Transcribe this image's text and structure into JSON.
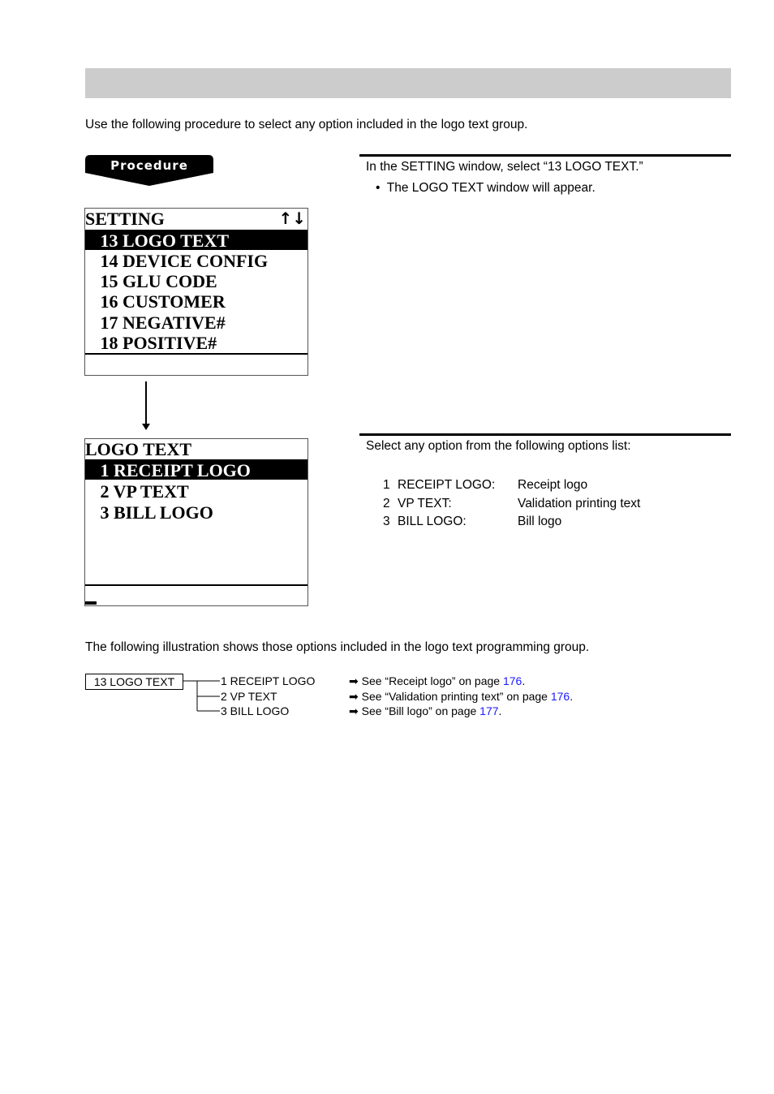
{
  "header": {
    "title": ""
  },
  "intro": "Use the following procedure to select any option included in the logo text group.",
  "procedure_label": "Procedure",
  "steps": [
    {
      "text": "In the SETTING window, select “13 LOGO TEXT.”",
      "bullet": "•",
      "bullet_text": "The LOGO TEXT window will appear."
    },
    {
      "text": "Select any option from the following options list:",
      "options": [
        {
          "num": "1",
          "name": "RECEIPT LOGO:",
          "desc": "Receipt logo"
        },
        {
          "num": "2",
          "name": "VP TEXT:",
          "desc": "Validation printing text"
        },
        {
          "num": "3",
          "name": "BILL LOGO:",
          "desc": "Bill logo"
        }
      ]
    }
  ],
  "setting_screen": {
    "title": "SETTING",
    "scroll_icon": "↑↓",
    "items": [
      " 13 LOGO TEXT",
      " 14 DEVICE CONFIG",
      " 15 GLU CODE",
      " 16 CUSTOMER",
      " 17 NEGATIVE#",
      " 18 POSITIVE#"
    ],
    "selected_index": 0
  },
  "logo_text_screen": {
    "title": "LOGO TEXT",
    "items": [
      " 1 RECEIPT LOGO",
      " 2 VP TEXT",
      " 3 BILL LOGO"
    ],
    "selected_index": 0
  },
  "illustration_text": "The following illustration shows those options included in the logo text programming group.",
  "tree": {
    "root": "13 LOGO TEXT",
    "children": [
      "1  RECEIPT LOGO",
      "2  VP TEXT",
      "3  BILL LOGO"
    ],
    "refs": [
      {
        "arrow": "➡",
        "prefix": "See “Receipt logo” on page ",
        "page": "176",
        "suffix": "."
      },
      {
        "arrow": "➡",
        "prefix": "See “Validation printing text” on page ",
        "page": "176",
        "suffix": "."
      },
      {
        "arrow": "➡",
        "prefix": "See “Bill logo” on page ",
        "page": "177",
        "suffix": "."
      }
    ]
  },
  "colors": {
    "header_bar": "#cccccc",
    "link": "#1a1aff"
  }
}
